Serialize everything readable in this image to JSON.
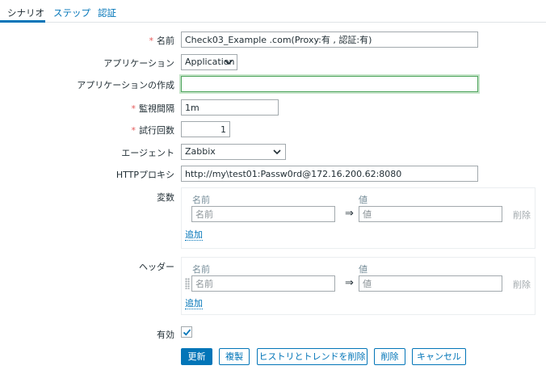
{
  "tabs": [
    {
      "label": "シナリオ",
      "active": true
    },
    {
      "label": "ステップ",
      "active": false
    },
    {
      "label": "認証",
      "active": false
    }
  ],
  "form": {
    "name": {
      "label": "名前",
      "value": "Check03_Example .com(Proxy:有 , 認証:有)",
      "required": true
    },
    "application": {
      "label": "アプリケーション",
      "value": "Application"
    },
    "new_application": {
      "label": "アプリケーションの作成",
      "value": ""
    },
    "interval": {
      "label": "監視間隔",
      "value": "1m",
      "required": true
    },
    "attempts": {
      "label": "試行回数",
      "value": "1",
      "required": true
    },
    "agent": {
      "label": "エージェント",
      "value": "Zabbix"
    },
    "proxy": {
      "label": "HTTPプロキシ",
      "value": "http://my\\test01:Passw0rd@172.16.200.62:8080"
    },
    "variables": {
      "label": "変数",
      "col_name": "名前",
      "col_value": "値",
      "name_placeholder": "名前",
      "value_placeholder": "値",
      "arrow": "⇒",
      "remove": "削除",
      "add": "追加"
    },
    "headers": {
      "label": "ヘッダー",
      "col_name": "名前",
      "col_value": "値",
      "name_placeholder": "名前",
      "value_placeholder": "値",
      "arrow": "⇒",
      "remove": "削除",
      "add": "追加"
    },
    "enabled": {
      "label": "有効",
      "checked": true
    }
  },
  "buttons": {
    "update": "更新",
    "clone": "複製",
    "clear_history": "ヒストリとトレンドを削除",
    "delete": "削除",
    "cancel": "キャンセル"
  },
  "colors": {
    "accent": "#0275b8",
    "required": "#e45959",
    "focus": "#4ea45c"
  }
}
